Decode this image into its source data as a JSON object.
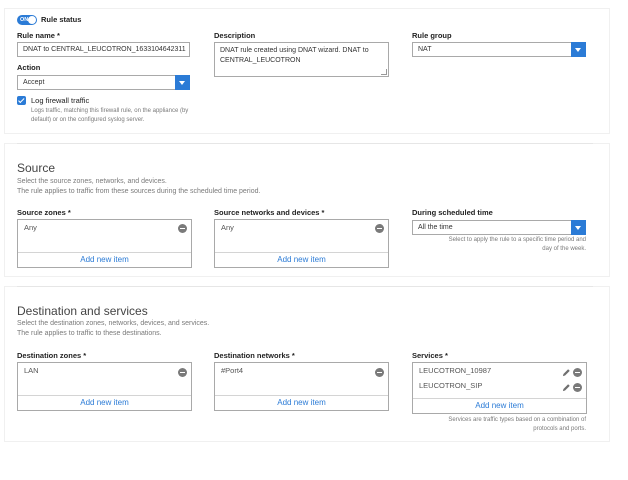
{
  "rule_status": {
    "toggle_label": "ON",
    "label": "Rule status"
  },
  "rule_name": {
    "label": "Rule name *",
    "value": "DNAT to CENTRAL_LEUCOTRON_1633104642311"
  },
  "description": {
    "label": "Description",
    "value": "DNAT rule created using DNAT wizard. DNAT to CENTRAL_LEUCOTRON"
  },
  "rule_group": {
    "label": "Rule group",
    "value": "NAT"
  },
  "action": {
    "label": "Action",
    "value": "Accept"
  },
  "log_traffic": {
    "label": "Log firewall traffic",
    "checked": true,
    "hint_line1": "Logs traffic, matching this firewall rule, on the appliance (by",
    "hint_line2": "default) or on the configured syslog server."
  },
  "source": {
    "title": "Source",
    "desc_line1": "Select the source zones, networks, and devices.",
    "desc_line2": "The rule applies to traffic from these sources during the scheduled time period.",
    "zones": {
      "label": "Source zones *",
      "items": [
        "Any"
      ],
      "add_label": "Add new item"
    },
    "networks": {
      "label": "Source networks and devices *",
      "items": [
        "Any"
      ],
      "add_label": "Add new item"
    },
    "schedule": {
      "label": "During scheduled time",
      "value": "All the time",
      "hint_line1": "Select to apply the rule to a specific time period and",
      "hint_line2": "day of the week."
    }
  },
  "destination": {
    "title": "Destination and services",
    "desc_line1": "Select the destination zones, networks, devices, and services.",
    "desc_line2": "The rule applies to traffic to these destinations.",
    "zones": {
      "label": "Destination zones *",
      "items": [
        "LAN"
      ],
      "add_label": "Add new item"
    },
    "networks": {
      "label": "Destination networks *",
      "items": [
        "#Port4"
      ],
      "add_label": "Add new item"
    },
    "services": {
      "label": "Services *",
      "items": [
        "LEUCOTRON_10987",
        "LEUCOTRON_SIP"
      ],
      "add_label": "Add new item",
      "hint_line1": "Services are traffic types based on a combination of",
      "hint_line2": "protocols and ports."
    }
  },
  "colors": {
    "accent": "#2b7bd6",
    "border": "#a9a9a9",
    "hint": "#7a7a7a"
  }
}
